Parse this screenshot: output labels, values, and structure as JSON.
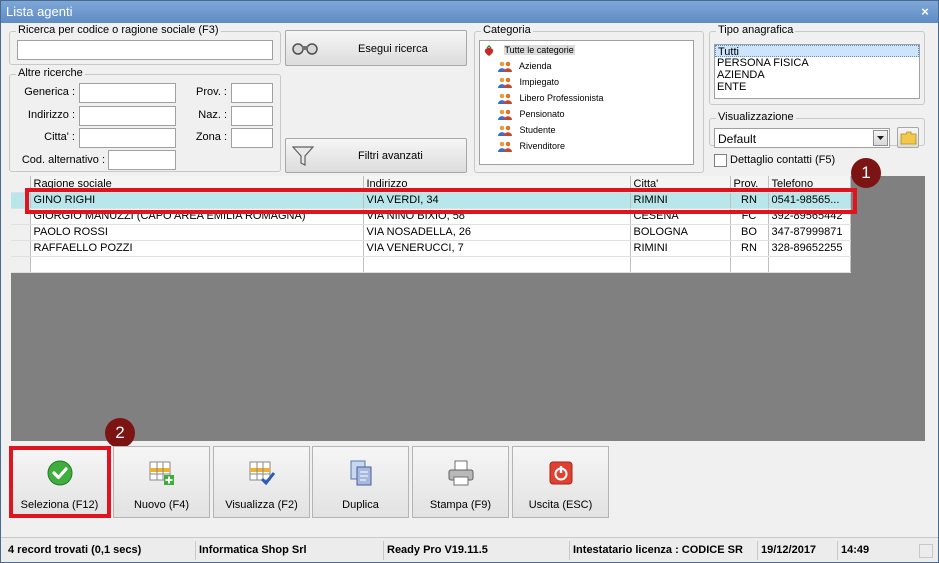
{
  "window": {
    "title": "Lista agenti",
    "close_glyph": "×"
  },
  "search": {
    "legend": "Ricerca per codice o ragione sociale (F3)",
    "value": "",
    "search_button": "Esegui ricerca",
    "search_icon": "binoculars-icon"
  },
  "other_search": {
    "legend": "Altre ricerche",
    "generica_label": "Generica :",
    "indirizzo_label": "Indirizzo :",
    "citta_label": "Citta' :",
    "cod_alt_label": "Cod. alternativo :",
    "prov_label": "Prov. :",
    "naz_label": "Naz. :",
    "zona_label": "Zona :",
    "advanced_button": "Filtri avanzati",
    "advanced_icon": "filter-funnel-icon"
  },
  "category": {
    "legend": "Categoria",
    "root": "Tutte le categorie",
    "items": [
      "Azienda",
      "Impiegato",
      "Libero Professionista",
      "Pensionato",
      "Studente",
      "Rivenditore"
    ]
  },
  "tipo_anagrafica": {
    "legend": "Tipo anagrafica",
    "options": [
      "Tutti",
      "PERSONA FISICA",
      "AZIENDA",
      "ENTE"
    ],
    "selected": "Tutti"
  },
  "visualizzazione": {
    "legend": "Visualizzazione",
    "selected": "Default",
    "checkbox_label": "Dettaglio contatti (F5)",
    "checkbox_checked": false
  },
  "grid": {
    "columns": [
      "Ragione sociale",
      "Indirizzo",
      "Citta'",
      "Prov.",
      "Telefono"
    ],
    "rows": [
      [
        "GINO RIGHI",
        "VIA VERDI, 34",
        "RIMINI",
        "RN",
        "0541-98565..."
      ],
      [
        "GIORGIO MANUZZI (CAPO AREA EMILIA ROMAGNA)",
        "VIA NINO BIXIO, 58",
        "CESENA",
        "FC",
        "392-89565442"
      ],
      [
        "PAOLO ROSSI",
        "VIA NOSADELLA, 26",
        "BOLOGNA",
        "BO",
        "347-87999871"
      ],
      [
        "RAFFAELLO POZZI",
        "VIA VENERUCCI, 7",
        "RIMINI",
        "RN",
        "328-89652255"
      ],
      [
        "",
        "",
        "",
        "",
        ""
      ]
    ]
  },
  "badges": {
    "one": "1",
    "two": "2"
  },
  "toolbar": {
    "seleziona": "Seleziona (F12)",
    "nuovo": "Nuovo (F4)",
    "visualizza": "Visualizza (F2)",
    "duplica": "Duplica",
    "stampa": "Stampa (F9)",
    "uscita": "Uscita (ESC)"
  },
  "status": {
    "records": "4 record trovati (0,1 secs)",
    "company": "Informatica Shop Srl",
    "version": "Ready Pro V19.11.5",
    "license": "Intestatario licenza : CODICE SR",
    "date": "19/12/2017",
    "time": "14:49"
  },
  "colors": {
    "highlight": "#e0141e",
    "badge": "#7c1414",
    "selected_row": "#b8e6ea",
    "title_bar": "#6f99ce"
  }
}
